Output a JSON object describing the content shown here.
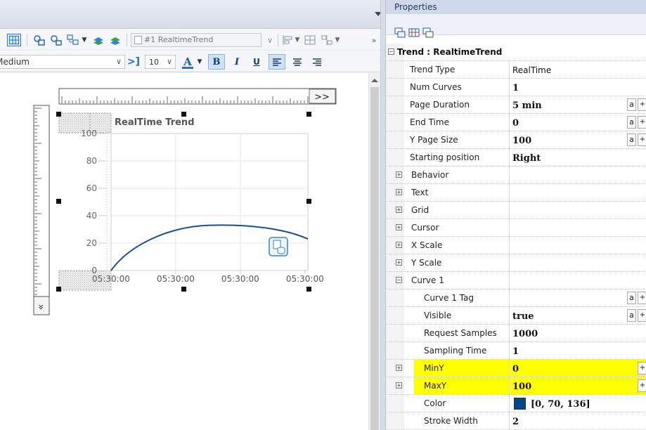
{
  "toolbar": {
    "trend_select": "#1 RealtimeTrend",
    "font_weight_select": "Medium",
    "font_size_select": "10",
    "bold_label": "B",
    "italic_label": "I",
    "underline_label": "U",
    "font_color_label": "A",
    "more_label": "»"
  },
  "trend_widget": {
    "ruler_button": ">>",
    "scroll_button": "»",
    "chart_title": "RealTime Trend",
    "curve_color": "#1b4f8f"
  },
  "chart_data": {
    "type": "line",
    "title": "RealTime Trend",
    "ylim": [
      0,
      100
    ],
    "yticks": [
      0,
      20,
      40,
      60,
      80,
      100
    ],
    "xticks": [
      "05:30:00",
      "05:30:00",
      "05:30:00",
      "05:30:00"
    ],
    "grid": true,
    "series": [
      {
        "values_x": [
          0,
          0.25,
          0.5,
          0.75,
          1.0
        ],
        "values_y": [
          0,
          27,
          33,
          33,
          23
        ]
      }
    ]
  },
  "properties": {
    "title": "Properties",
    "section": "Trend : RealtimeTrend",
    "rows": [
      {
        "key": "Trend Type",
        "value": "RealTime"
      },
      {
        "key": "Num Curves",
        "value": "1"
      },
      {
        "key": "Page Duration",
        "value": "5 min"
      },
      {
        "key": "End Time",
        "value": "0"
      },
      {
        "key": "Y Page Size",
        "value": "100"
      },
      {
        "key": "Starting position",
        "value": "Right"
      },
      {
        "key": "Behavior",
        "value": ""
      },
      {
        "key": "Text",
        "value": ""
      },
      {
        "key": "Grid",
        "value": ""
      },
      {
        "key": "Cursor",
        "value": ""
      },
      {
        "key": "X Scale",
        "value": ""
      },
      {
        "key": "Y Scale",
        "value": ""
      },
      {
        "key": "Curve 1",
        "value": ""
      },
      {
        "key": "Curve 1 Tag",
        "value": ""
      },
      {
        "key": "Visible",
        "value": "true"
      },
      {
        "key": "Request Samples",
        "value": "1000"
      },
      {
        "key": "Sampling Time",
        "value": "1"
      },
      {
        "key": "MinY",
        "value": "0"
      },
      {
        "key": "MaxY",
        "value": "100"
      },
      {
        "key": "Color",
        "value": "[0, 70, 136]"
      },
      {
        "key": "Stroke Width",
        "value": "2"
      }
    ],
    "button_a": "a",
    "button_plus": "+",
    "color_swatch": "#004688"
  }
}
